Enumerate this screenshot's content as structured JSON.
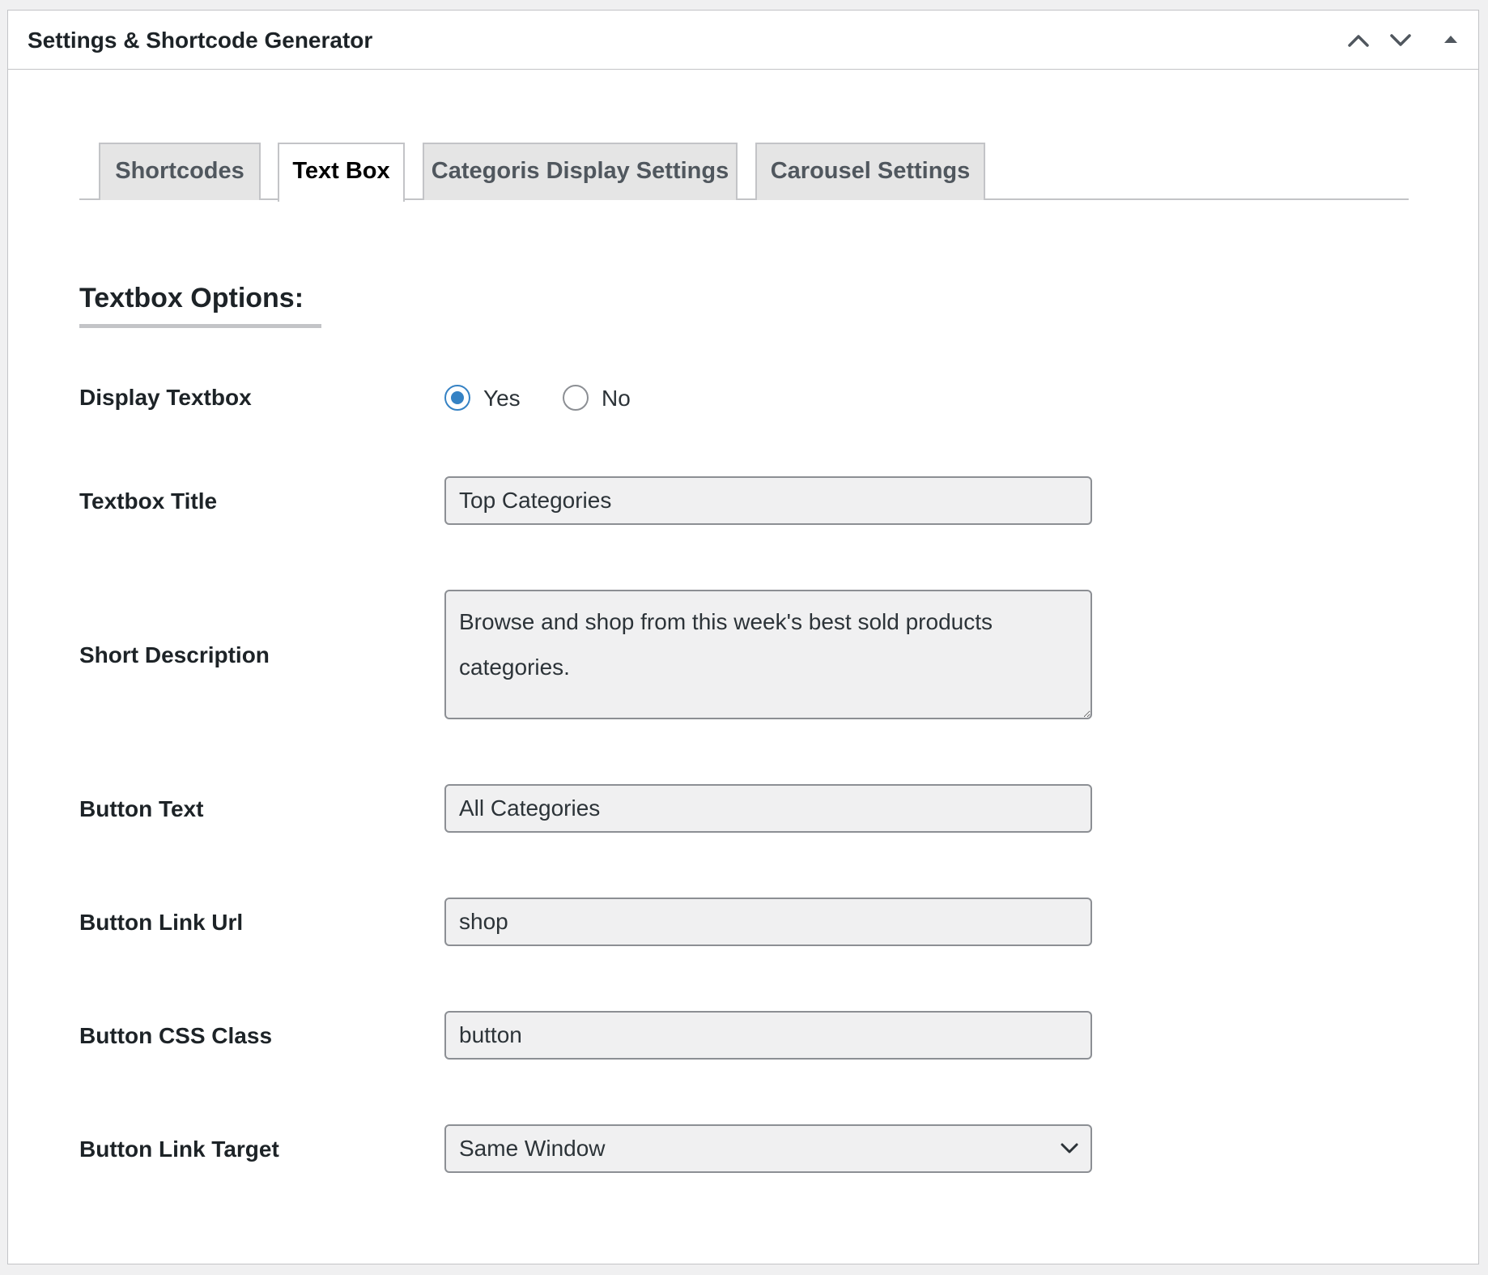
{
  "header": {
    "title": "Settings & Shortcode Generator",
    "move_up_icon": "chevron-up-icon",
    "move_down_icon": "chevron-down-icon",
    "toggle_icon": "triangle-up-icon"
  },
  "tabs": [
    {
      "label": "Shortcodes",
      "active": false
    },
    {
      "label": "Text Box",
      "active": true
    },
    {
      "label": "Categoris Display Settings",
      "active": false
    },
    {
      "label": "Carousel Settings",
      "active": false
    }
  ],
  "section": {
    "heading": "Textbox Options:"
  },
  "fields": {
    "display_textbox": {
      "label": "Display Textbox",
      "options": [
        {
          "label": "Yes",
          "checked": true
        },
        {
          "label": "No",
          "checked": false
        }
      ]
    },
    "textbox_title": {
      "label": "Textbox Title",
      "value": "Top Categories"
    },
    "short_description": {
      "label": "Short Description",
      "value": "Browse and shop from this week's best sold products categories."
    },
    "button_text": {
      "label": "Button Text",
      "value": "All Categories"
    },
    "button_link_url": {
      "label": "Button Link Url",
      "value": "shop"
    },
    "button_css_class": {
      "label": "Button CSS Class",
      "value": "button"
    },
    "button_link_target": {
      "label": "Button Link Target",
      "selected": "Same Window"
    }
  },
  "colors": {
    "accent": "#3582c4",
    "border": "#c3c4c7",
    "input_bg": "#f0f0f1",
    "text": "#1d2327"
  }
}
